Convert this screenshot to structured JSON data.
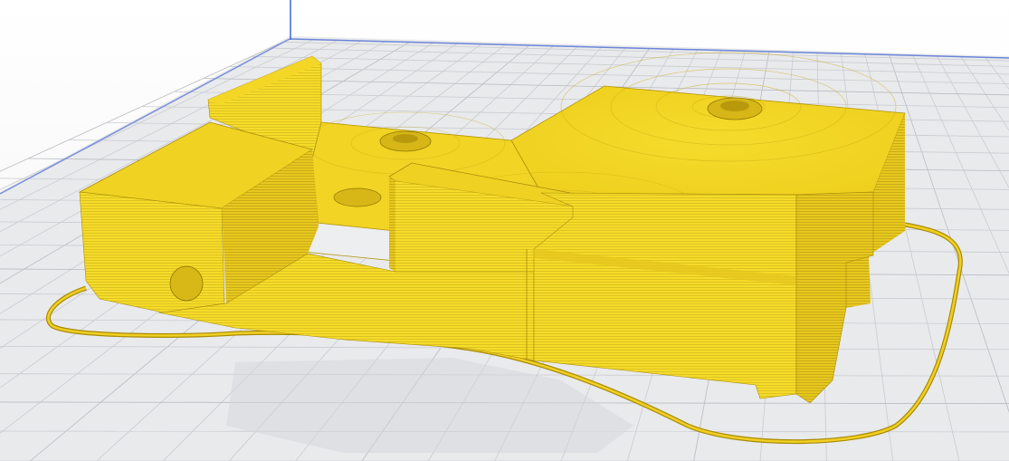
{
  "viewport": {
    "background": "#ffffff",
    "build_plate": {
      "surface": "#e9eaec",
      "grid_line": "#c9cbcf",
      "grid_line_major": "#b8bbc0",
      "edge_back": "#6b86d9",
      "edge_left": "#7a90dc",
      "corner_axis": "#3b6ad8"
    }
  },
  "model": {
    "main_color": "#f6dc2a",
    "top_color": "#f2d522",
    "shade_color": "#e2c21a",
    "dark_color": "#c6a70f",
    "line_color": "#9c8206",
    "shadow_color": "#cfd0d3"
  },
  "skirt": {
    "color": "#e8c51c",
    "outline": "#a88a05"
  }
}
